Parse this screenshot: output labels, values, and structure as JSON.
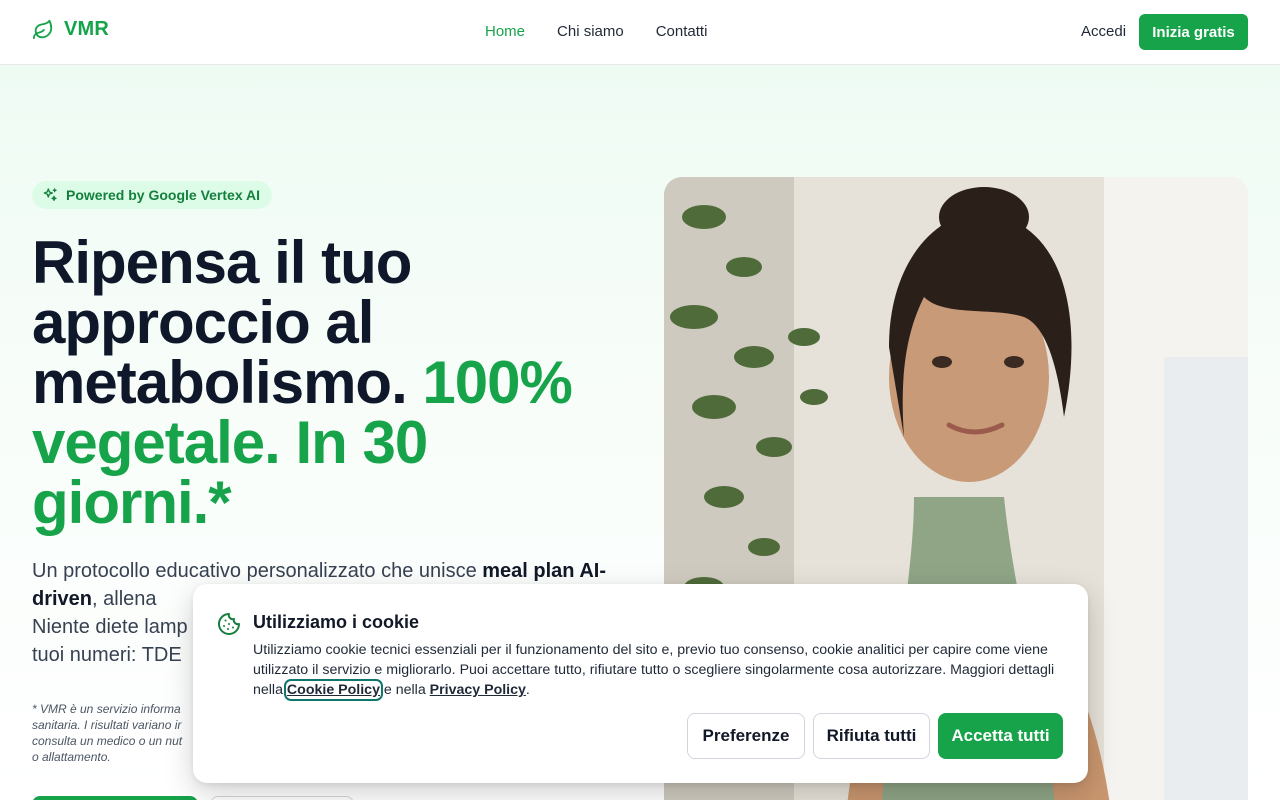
{
  "header": {
    "logo_text": "VMR",
    "nav": [
      {
        "label": "Home",
        "active": true
      },
      {
        "label": "Chi siamo",
        "active": false
      },
      {
        "label": "Contatti",
        "active": false
      }
    ],
    "login_label": "Accedi",
    "cta_label": "Inizia gratis"
  },
  "hero": {
    "badge": "Powered by Google Vertex AI",
    "headline_dark": "Ripensa il tuo approccio al metabolismo.",
    "headline_green": "100% vegetale. In 30 giorni.*",
    "lead_1": "Un protocollo educativo personalizzato che unisce ",
    "lead_bold": "meal plan AI-driven",
    "lead_2": ", allena",
    "lead_3": "Niente diete lamp",
    "lead_4": "tuoi numeri: TDE",
    "disclaimer_1": "* VMR è un servizio informa",
    "disclaimer_2": "sanitaria. I risultati variano ir",
    "disclaimer_3": "consulta un medico o un nut",
    "disclaimer_4": "o allattamento."
  },
  "cookie": {
    "title": "Utilizziamo i cookie",
    "text_1": "Utilizziamo cookie tecnici essenziali per il funzionamento del sito e, previo tuo consenso, cookie analitici per capire come viene utilizzato il servizio e migliorarlo. Puoi accettare tutto, rifiutare tutto o scegliere singolarmente cosa autorizzare. Maggiori dettagli nella ",
    "cookie_policy": "Cookie Policy",
    "text_2": " e nella ",
    "privacy_policy": "Privacy Policy",
    "text_3": ".",
    "btn_preferences": "Preferenze",
    "btn_reject": "Rifiuta tutti",
    "btn_accept": "Accetta tutti"
  },
  "colors": {
    "brand": "#16a34a",
    "heading": "#0f172a"
  }
}
